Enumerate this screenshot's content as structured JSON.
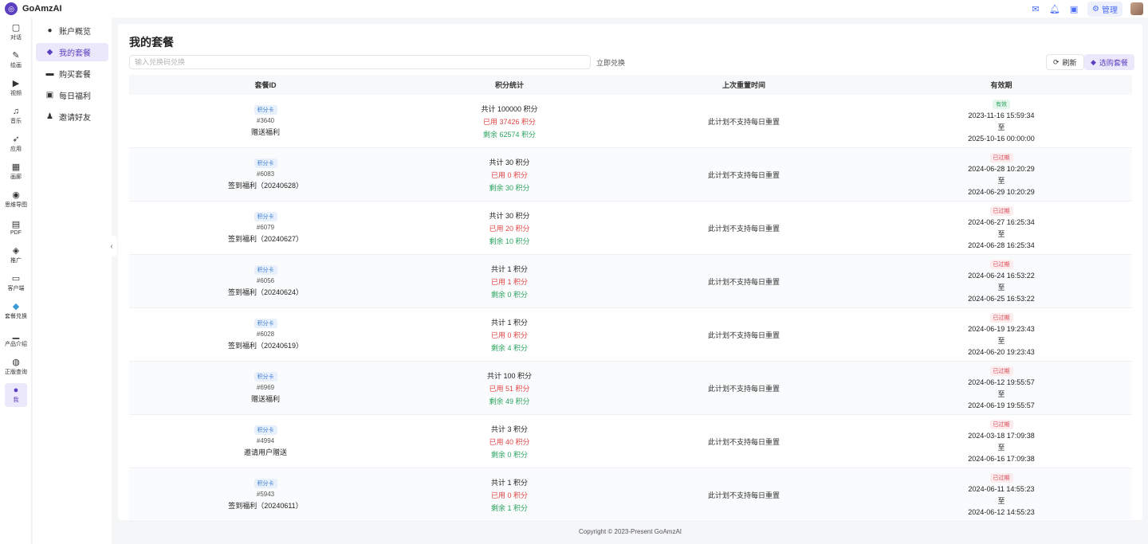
{
  "app": {
    "name": "GoAmzAI"
  },
  "topbar": {
    "admin_label": "管理"
  },
  "rail": [
    {
      "label": "对话",
      "icon": "chat-icon"
    },
    {
      "label": "绘画",
      "icon": "paint-icon"
    },
    {
      "label": "视频",
      "icon": "video-icon"
    },
    {
      "label": "音乐",
      "icon": "music-icon"
    },
    {
      "label": "应用",
      "icon": "rocket-icon"
    },
    {
      "label": "画廊",
      "icon": "gallery-icon"
    },
    {
      "label": "思维导图",
      "icon": "mindmap-icon"
    },
    {
      "label": "PDF",
      "icon": "pdf-icon"
    },
    {
      "label": "推广",
      "icon": "promote-icon"
    },
    {
      "label": "客户端",
      "icon": "desktop-icon"
    },
    {
      "label": "套餐兑换",
      "icon": "diamond-icon"
    },
    {
      "label": "产品介绍",
      "icon": "book-icon"
    },
    {
      "label": "正版查询",
      "icon": "verify-icon"
    },
    {
      "label": "我",
      "icon": "user-icon"
    }
  ],
  "subnav": [
    {
      "label": "账户概览",
      "icon": "user-icon"
    },
    {
      "label": "我的套餐",
      "icon": "diamond-icon"
    },
    {
      "label": "购买套餐",
      "icon": "card-icon"
    },
    {
      "label": "每日福利",
      "icon": "gift-icon"
    },
    {
      "label": "邀请好友",
      "icon": "invite-icon"
    }
  ],
  "page": {
    "title": "我的套餐",
    "redeem_placeholder": "输入兑换码兑换",
    "redeem_button": "立即兑换",
    "refresh_button": "刷新",
    "buy_button": "选购套餐"
  },
  "table": {
    "headers": [
      "套餐ID",
      "积分统计",
      "上次重置时间",
      "有效期"
    ],
    "rows": [
      {
        "tag": "积分卡",
        "id": "#3640",
        "name": "赠送福利",
        "total": "共计 100000 积分",
        "used": "已用 37426 积分",
        "left": "剩余 62574 积分",
        "reset": "此计划不支持每日重置",
        "status": "有效",
        "status_type": "valid",
        "start": "2023-11-16 15:59:34",
        "to": "至",
        "end": "2025-10-16 00:00:00"
      },
      {
        "tag": "积分卡",
        "id": "#6083",
        "name": "签到福利（20240628）",
        "total": "共计 30 积分",
        "used": "已用 0 积分",
        "left": "剩余 30 积分",
        "reset": "此计划不支持每日重置",
        "status": "已过期",
        "status_type": "expired",
        "start": "2024-06-28 10:20:29",
        "to": "至",
        "end": "2024-06-29 10:20:29"
      },
      {
        "tag": "积分卡",
        "id": "#6079",
        "name": "签到福利（20240627）",
        "total": "共计 30 积分",
        "used": "已用 20 积分",
        "left": "剩余 10 积分",
        "reset": "此计划不支持每日重置",
        "status": "已过期",
        "status_type": "expired",
        "start": "2024-06-27 16:25:34",
        "to": "至",
        "end": "2024-06-28 16:25:34"
      },
      {
        "tag": "积分卡",
        "id": "#6056",
        "name": "签到福利（20240624）",
        "total": "共计 1 积分",
        "used": "已用 1 积分",
        "left": "剩余 0 积分",
        "reset": "此计划不支持每日重置",
        "status": "已过期",
        "status_type": "expired",
        "start": "2024-06-24 16:53:22",
        "to": "至",
        "end": "2024-06-25 16:53:22"
      },
      {
        "tag": "积分卡",
        "id": "#6028",
        "name": "签到福利（20240619）",
        "total": "共计 1 积分",
        "used": "已用 0 积分",
        "left": "剩余 4 积分",
        "reset": "此计划不支持每日重置",
        "status": "已过期",
        "status_type": "expired",
        "start": "2024-06-19 19:23:43",
        "to": "至",
        "end": "2024-06-20 19:23:43"
      },
      {
        "tag": "积分卡",
        "id": "#6969",
        "name": "赠送福利",
        "total": "共计 100 积分",
        "used": "已用 51 积分",
        "left": "剩余 49 积分",
        "reset": "此计划不支持每日重置",
        "status": "已过期",
        "status_type": "expired",
        "start": "2024-06-12 19:55:57",
        "to": "至",
        "end": "2024-06-19 19:55:57"
      },
      {
        "tag": "积分卡",
        "id": "#4994",
        "name": "邀请用户赠送",
        "total": "共计 3 积分",
        "used": "已用 40 积分",
        "left": "剩余 0 积分",
        "reset": "此计划不支持每日重置",
        "status": "已过期",
        "status_type": "expired",
        "start": "2024-03-18 17:09:38",
        "to": "至",
        "end": "2024-06-16 17:09:38"
      },
      {
        "tag": "积分卡",
        "id": "#5943",
        "name": "签到福利（20240611）",
        "total": "共计 1 积分",
        "used": "已用 0 积分",
        "left": "剩余 1 积分",
        "reset": "此计划不支持每日重置",
        "status": "已过期",
        "status_type": "expired",
        "start": "2024-06-11 14:55:23",
        "to": "至",
        "end": "2024-06-12 14:55:23"
      }
    ]
  },
  "footer": {
    "text": "Copyright © 2023-Present GoAmzAI"
  },
  "colors": {
    "accent": "#5a3fc0",
    "used": "#e04545",
    "remaining": "#2aa35f"
  }
}
